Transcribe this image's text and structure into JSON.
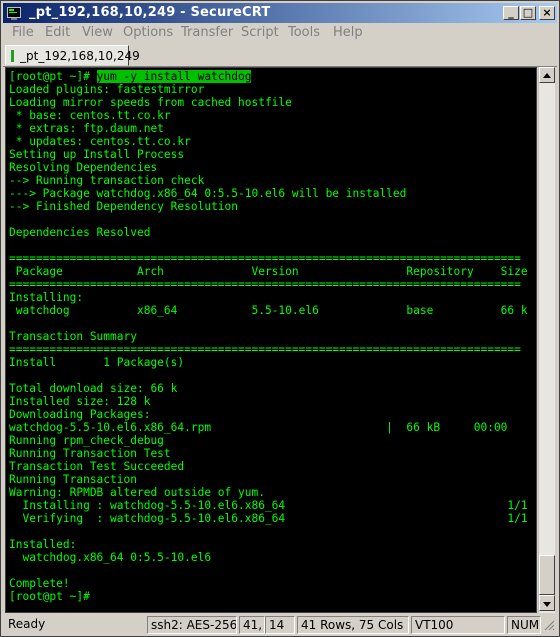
{
  "window": {
    "title": "_pt_192,168,10,249 - SecureCRT",
    "minimize_glyph": "_",
    "maximize_glyph": "□",
    "close_glyph": "×"
  },
  "menu": [
    "File",
    "Edit",
    "View",
    "Options",
    "Transfer",
    "Script",
    "Tools",
    "Help"
  ],
  "tab": {
    "label": "_pt_192,168,10,249",
    "status_color": "#20a020"
  },
  "terminal": {
    "foreground": "#00ff00",
    "background": "#000000",
    "prompt": "[root@pt ~]# ",
    "command": "yum -y install watchdog",
    "lines": [
      "Loaded plugins: fastestmirror",
      "Loading mirror speeds from cached hostfile",
      " * base: centos.tt.co.kr",
      " * extras: ftp.daum.net",
      " * updates: centos.tt.co.kr",
      "Setting up Install Process",
      "Resolving Dependencies",
      "--> Running transaction check",
      "---> Package watchdog.x86_64 0:5.5-10.el6 will be installed",
      "--> Finished Dependency Resolution",
      "",
      "Dependencies Resolved",
      "",
      "============================================================================",
      " Package           Arch             Version                Repository    Size",
      "============================================================================",
      "Installing:",
      " watchdog          x86_64           5.5-10.el6             base          66 k",
      "",
      "Transaction Summary",
      "============================================================================",
      "Install       1 Package(s)",
      "",
      "Total download size: 66 k",
      "Installed size: 128 k",
      "Downloading Packages:",
      "watchdog-5.5-10.el6.x86_64.rpm                          |  66 kB     00:00",
      "Running rpm_check_debug",
      "Running Transaction Test",
      "Transaction Test Succeeded",
      "Running Transaction",
      "Warning: RPMDB altered outside of yum.",
      "  Installing : watchdog-5.5-10.el6.x86_64                                 1/1",
      "  Verifying  : watchdog-5.5-10.el6.x86_64                                 1/1",
      "",
      "Installed:",
      "  watchdog.x86_64 0:5.5-10.el6",
      "",
      "Complete!",
      "[root@pt ~]#"
    ]
  },
  "status": {
    "ready": "Ready",
    "cipher": "ssh2: AES-256",
    "row": "41,",
    "col": "14",
    "dims": "41 Rows,  75 Cols",
    "term": "VT100",
    "num": "NUM"
  }
}
